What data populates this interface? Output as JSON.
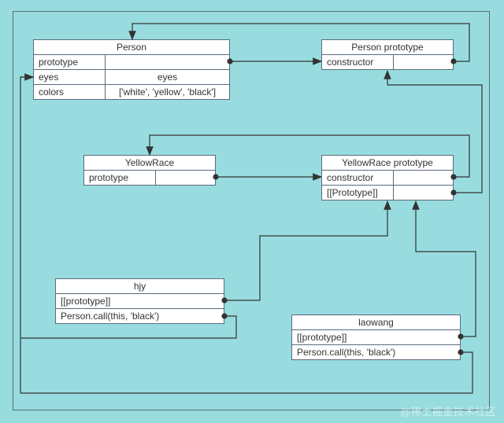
{
  "boxes": {
    "person": {
      "title": "Person",
      "rows": [
        {
          "k": "prototype",
          "v": ""
        },
        {
          "k": "eyes",
          "v": "eyes"
        },
        {
          "k": "colors",
          "v": "['white', 'yellow', 'black']"
        }
      ]
    },
    "personProto": {
      "title": "Person prototype",
      "rows": [
        {
          "k": "constructor",
          "v": ""
        }
      ]
    },
    "yellowRace": {
      "title": "YellowRace",
      "rows": [
        {
          "k": "prototype",
          "v": ""
        }
      ]
    },
    "yellowRaceProto": {
      "title": "YellowRace prototype",
      "rows": [
        {
          "k": "constructor",
          "v": ""
        },
        {
          "k": "[[Prototype]]",
          "v": ""
        }
      ]
    },
    "hjy": {
      "title": "hjy",
      "rows": [
        {
          "k": "[[prototype]]",
          "v": ""
        },
        {
          "k": "Person.call(this, 'black')",
          "v": ""
        }
      ]
    },
    "laowang": {
      "title": "laowang",
      "rows": [
        {
          "k": "[[prototype]]",
          "v": ""
        },
        {
          "k": "Person.call(this, 'black')",
          "v": ""
        }
      ]
    }
  },
  "watermark": "@稀土掘金技术社区"
}
